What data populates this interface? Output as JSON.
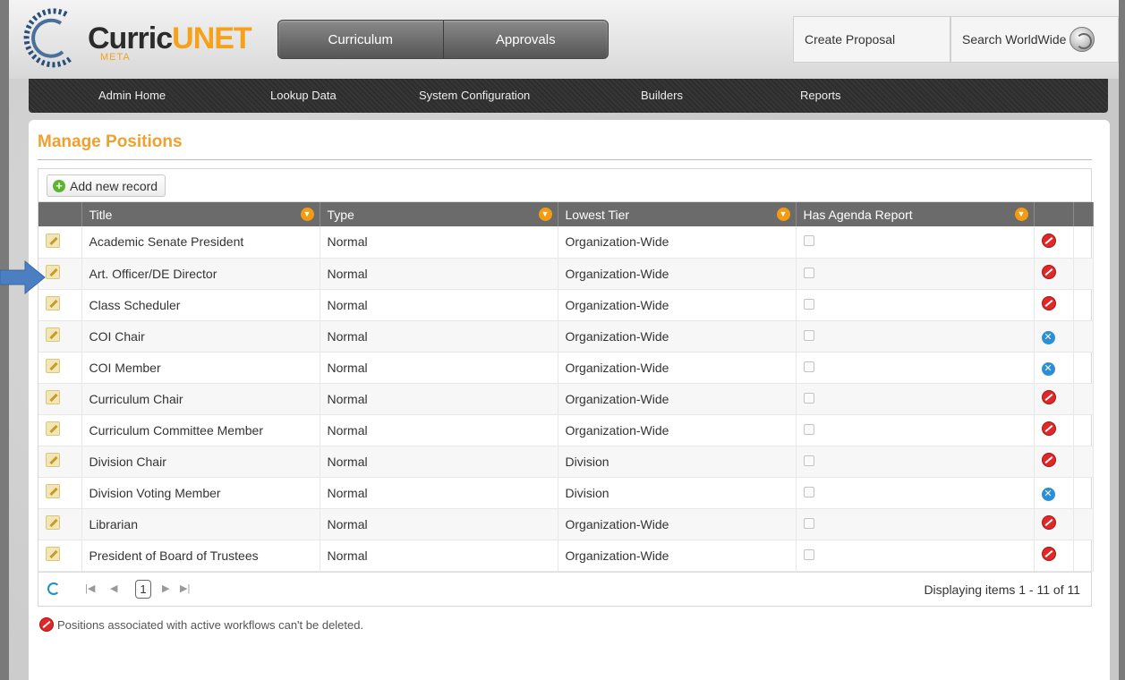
{
  "header": {
    "logo_main": "Curric",
    "logo_accent": "UNET",
    "logo_sub": "META",
    "tabs": [
      "Curriculum",
      "Approvals"
    ],
    "create_proposal": "Create Proposal",
    "search": "Search WorldWide"
  },
  "subnav": [
    "Admin Home",
    "Lookup Data",
    "System Configuration",
    "Builders",
    "Reports"
  ],
  "page": {
    "title": "Manage Positions",
    "add_button": "Add new record",
    "columns": [
      "Title",
      "Type",
      "Lowest Tier",
      "Has Agenda Report"
    ],
    "rows": [
      {
        "title": "Academic Senate President",
        "type": "Normal",
        "tier": "Organization-Wide",
        "delete": "locked"
      },
      {
        "title": "Art. Officer/DE Director",
        "type": "Normal",
        "tier": "Organization-Wide",
        "delete": "locked"
      },
      {
        "title": "Class Scheduler",
        "type": "Normal",
        "tier": "Organization-Wide",
        "delete": "locked"
      },
      {
        "title": "COI Chair",
        "type": "Normal",
        "tier": "Organization-Wide",
        "delete": "delete"
      },
      {
        "title": "COI Member",
        "type": "Normal",
        "tier": "Organization-Wide",
        "delete": "delete"
      },
      {
        "title": "Curriculum Chair",
        "type": "Normal",
        "tier": "Organization-Wide",
        "delete": "locked"
      },
      {
        "title": "Curriculum Committee Member",
        "type": "Normal",
        "tier": "Organization-Wide",
        "delete": "locked"
      },
      {
        "title": "Division Chair",
        "type": "Normal",
        "tier": "Division",
        "delete": "locked"
      },
      {
        "title": "Division Voting Member",
        "type": "Normal",
        "tier": "Division",
        "delete": "delete"
      },
      {
        "title": "Librarian",
        "type": "Normal",
        "tier": "Organization-Wide",
        "delete": "locked"
      },
      {
        "title": "President of Board of Trustees",
        "type": "Normal",
        "tier": "Organization-Wide",
        "delete": "locked"
      }
    ],
    "pager": {
      "current_page": "1",
      "info": "Displaying items 1 - 11 of 11"
    },
    "note": "Positions associated with active workflows can't be deleted."
  }
}
